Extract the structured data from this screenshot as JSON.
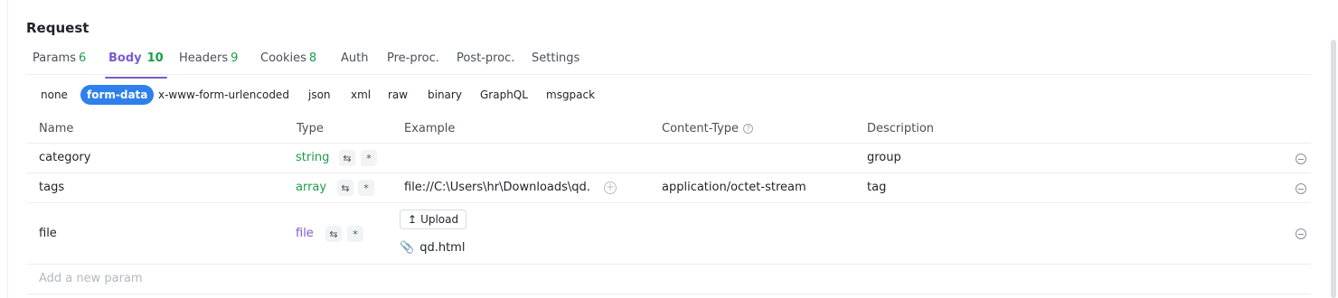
{
  "title": "Request",
  "tabs": [
    {
      "label": "Params",
      "count": "6"
    },
    {
      "label": "Body",
      "count": "10"
    },
    {
      "label": "Headers",
      "count": "9"
    },
    {
      "label": "Cookies",
      "count": "8"
    },
    {
      "label": "Auth",
      "count": ""
    },
    {
      "label": "Pre-proc.",
      "count": ""
    },
    {
      "label": "Post-proc.",
      "count": ""
    },
    {
      "label": "Settings",
      "count": ""
    }
  ],
  "body_types": [
    "none",
    "form-data",
    "x-www-form-urlencoded",
    "json",
    "xml",
    "raw",
    "binary",
    "GraphQL",
    "msgpack"
  ],
  "columns": {
    "name": "Name",
    "type": "Type",
    "example": "Example",
    "content_type": "Content-Type",
    "description": "Description"
  },
  "rows": [
    {
      "name": "category",
      "type": "string",
      "example": "",
      "content_type": "",
      "description": "group"
    },
    {
      "name": "tags",
      "type": "array",
      "example": "file://C:\\Users\\hr\\Downloads\\qd.h",
      "content_type": "application/octet-stream",
      "description": "tag"
    },
    {
      "name": "file",
      "type": "file",
      "upload_label": "Upload",
      "file_name": "qd.html",
      "content_type": "",
      "description": ""
    }
  ],
  "add_placeholder": "Add a new param",
  "icons": {
    "toggle": "settings-toggle-icon",
    "required": "asterisk-icon",
    "remove": "minus-circle-icon",
    "help": "question-circle-icon",
    "add": "plus-circle-icon",
    "upload": "upload-icon",
    "attachment": "paperclip-icon"
  },
  "colors": {
    "accent": "#7a5ccf",
    "active_pill": "#2f80ed",
    "type_green": "#1a9e4a",
    "type_purple": "#7a5ccf"
  }
}
